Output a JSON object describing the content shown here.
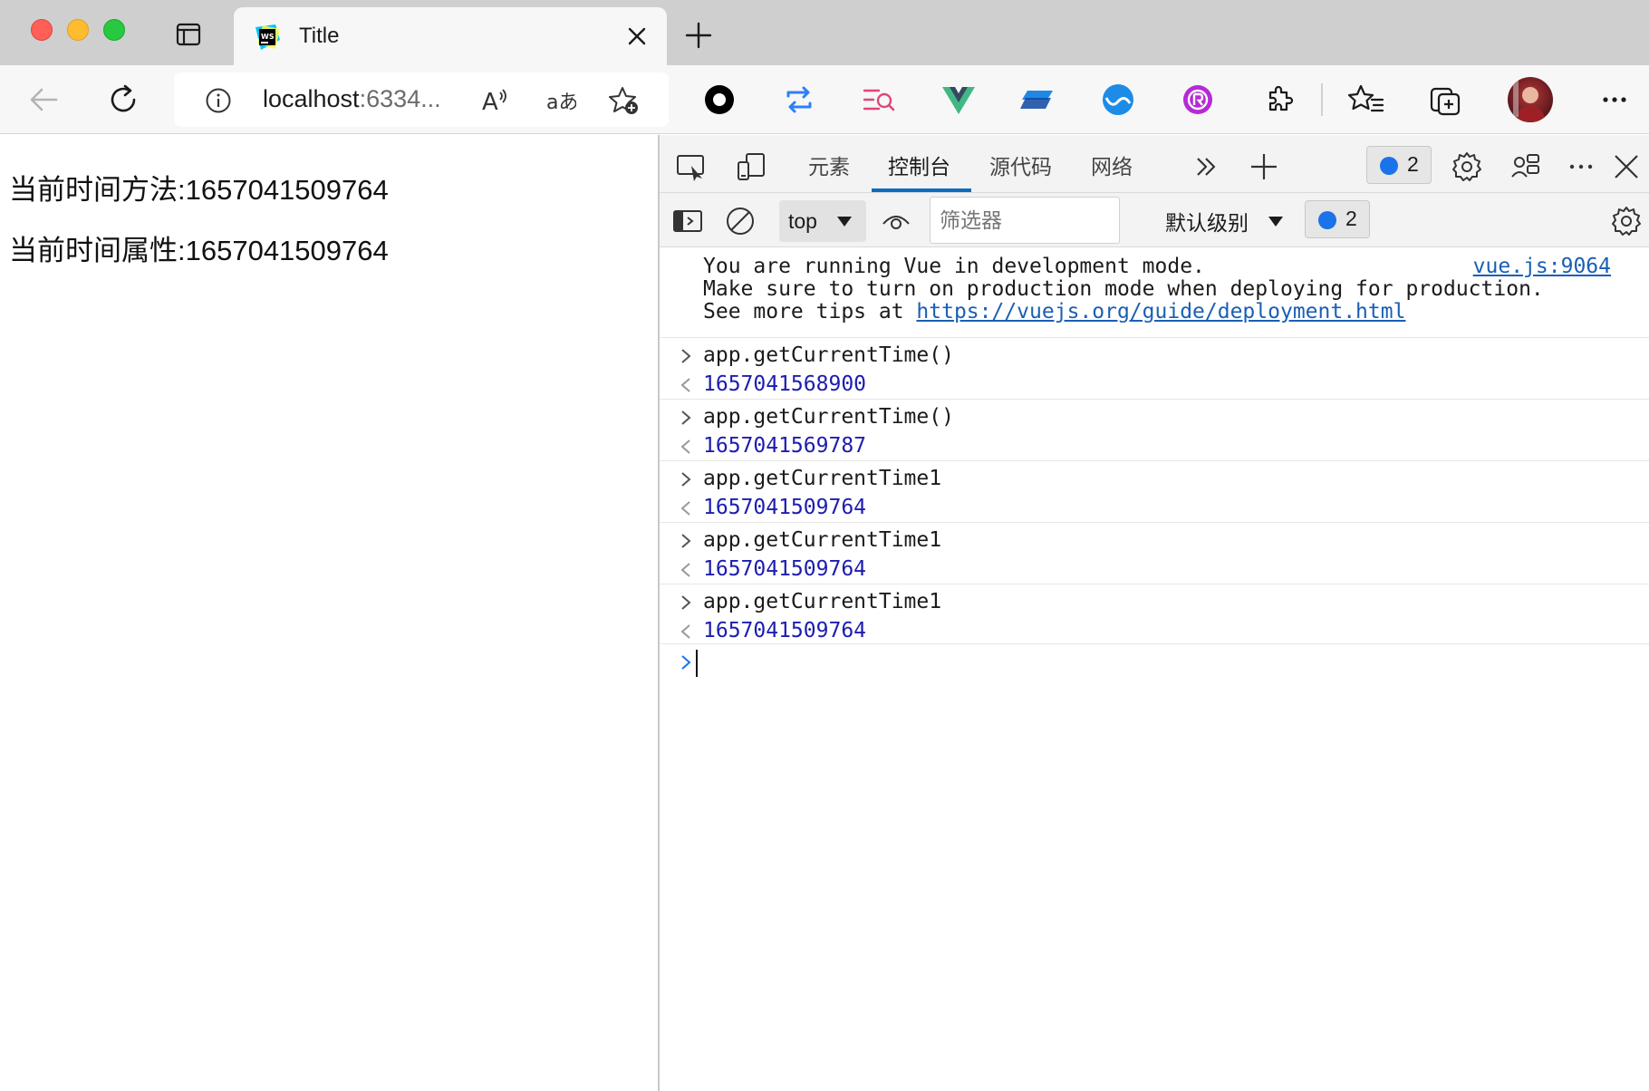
{
  "tab": {
    "title": "Title"
  },
  "address": {
    "host": "localhost",
    "port": ":6334..."
  },
  "page": {
    "line1": "当前时间方法:1657041509764",
    "line2": "当前时间属性:1657041509764"
  },
  "devtools": {
    "tabs": [
      {
        "label": "元素"
      },
      {
        "label": "控制台"
      },
      {
        "label": "源代码"
      },
      {
        "label": "网络"
      }
    ],
    "issues_count": "2",
    "context": "top",
    "filter_placeholder": "筛选器",
    "level": "默认级别",
    "filter_issues_count": "2"
  },
  "console": {
    "vue_msg": {
      "line1": "You are running Vue in development mode.",
      "line2": "Make sure to turn on production mode when deploying for production.",
      "line3_prefix": "See more tips at ",
      "line3_link": "https://vuejs.org/guide/deployment.html",
      "source": "vue.js:9064"
    },
    "entries": [
      {
        "input": "app.getCurrentTime()",
        "output": "1657041568900"
      },
      {
        "input": "app.getCurrentTime()",
        "output": "1657041569787"
      },
      {
        "input": "app.getCurrentTime1",
        "output": "1657041509764"
      },
      {
        "input": "app.getCurrentTime1",
        "output": "1657041509764"
      },
      {
        "input": "app.getCurrentTime1",
        "output": "1657041509764"
      }
    ]
  },
  "icons": {
    "toolbar": [
      "back-icon",
      "refresh-icon",
      "info-icon",
      "read-aloud-icon",
      "translate-icon",
      "add-favorite-icon",
      "circle-extension-icon",
      "sync-extension-icon",
      "search-extension-icon",
      "vue-devtools-icon",
      "layers-extension-icon",
      "wave-extension-icon",
      "purple-extension-icon",
      "extensions-icon",
      "favorites-icon",
      "collections-icon",
      "profile-avatar",
      "more-icon"
    ]
  }
}
